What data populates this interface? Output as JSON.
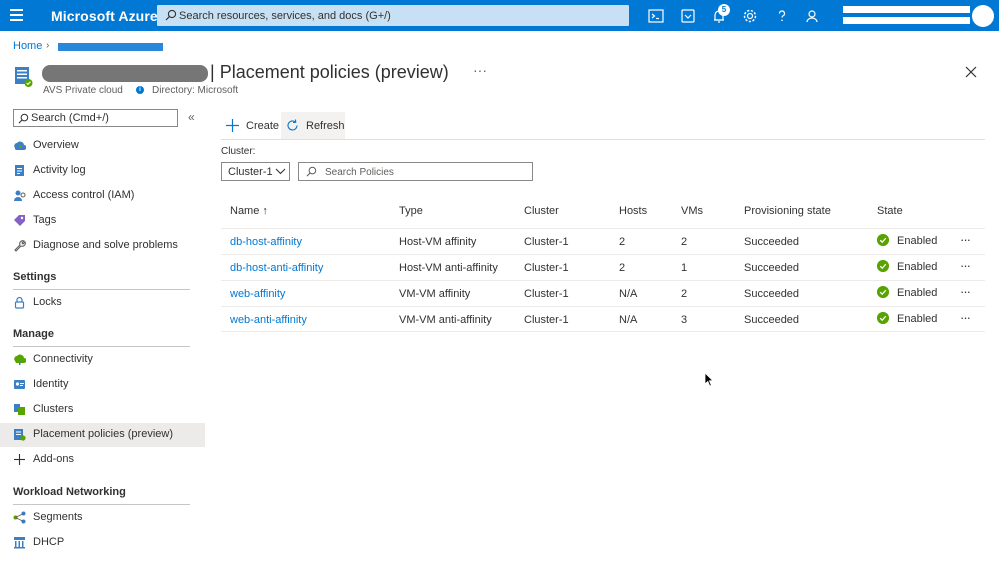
{
  "topbar": {
    "brand": "Microsoft Azure",
    "search_placeholder": "Search resources, services, and docs (G+/)",
    "notification_count": "5",
    "icons": [
      "cloud-shell-icon",
      "directory-filter-icon",
      "notifications-icon",
      "settings-icon",
      "help-icon",
      "feedback-icon"
    ],
    "accent": "#0078d4"
  },
  "breadcrumb": {
    "home": "Home"
  },
  "header": {
    "title": "Placement policies (preview)",
    "title_prefix": "|",
    "more": "···",
    "resource_type": "AVS Private cloud",
    "directory": "Directory: Microsoft"
  },
  "sidebar": {
    "search_placeholder": "Search (Cmd+/)",
    "collapse": "«",
    "top_items": [
      {
        "label": "Overview",
        "icon": "overview-icon"
      },
      {
        "label": "Activity log",
        "icon": "activity-log-icon"
      },
      {
        "label": "Access control (IAM)",
        "icon": "iam-icon"
      },
      {
        "label": "Tags",
        "icon": "tag-icon"
      },
      {
        "label": "Diagnose and solve problems",
        "icon": "wrench-icon"
      }
    ],
    "settings": {
      "title": "Settings",
      "items": [
        {
          "label": "Locks",
          "icon": "lock-icon"
        }
      ]
    },
    "manage": {
      "title": "Manage",
      "items": [
        {
          "label": "Connectivity",
          "icon": "connectivity-icon"
        },
        {
          "label": "Identity",
          "icon": "identity-icon"
        },
        {
          "label": "Clusters",
          "icon": "clusters-icon"
        },
        {
          "label": "Placement policies (preview)",
          "icon": "placement-policies-icon",
          "active": true
        },
        {
          "label": "Add-ons",
          "icon": "plus-icon"
        }
      ]
    },
    "workload": {
      "title": "Workload Networking",
      "items": [
        {
          "label": "Segments",
          "icon": "segments-icon"
        },
        {
          "label": "DHCP",
          "icon": "dhcp-icon"
        }
      ]
    }
  },
  "toolbar": {
    "create": "Create",
    "refresh": "Refresh"
  },
  "filters": {
    "cluster_label": "Cluster:",
    "cluster_value": "Cluster-1",
    "search_placeholder": "Search Policies"
  },
  "table": {
    "headers": {
      "name": "Name ↑",
      "type": "Type",
      "cluster": "Cluster",
      "hosts": "Hosts",
      "vms": "VMs",
      "provisioning": "Provisioning state",
      "state": "State"
    },
    "rows": [
      {
        "name": "db-host-affinity",
        "type": "Host-VM affinity",
        "cluster": "Cluster-1",
        "hosts": "2",
        "vms": "2",
        "provisioning": "Succeeded",
        "state": "Enabled",
        "more": "···"
      },
      {
        "name": "db-host-anti-affinity",
        "type": "Host-VM anti-affinity",
        "cluster": "Cluster-1",
        "hosts": "2",
        "vms": "1",
        "provisioning": "Succeeded",
        "state": "Enabled",
        "more": "···"
      },
      {
        "name": "web-affinity",
        "type": "VM-VM affinity",
        "cluster": "Cluster-1",
        "hosts": "N/A",
        "vms": "2",
        "provisioning": "Succeeded",
        "state": "Enabled",
        "more": "···"
      },
      {
        "name": "web-anti-affinity",
        "type": "VM-VM anti-affinity",
        "cluster": "Cluster-1",
        "hosts": "N/A",
        "vms": "3",
        "provisioning": "Succeeded",
        "state": "Enabled",
        "more": "···"
      }
    ],
    "status_color": "#57a300"
  }
}
